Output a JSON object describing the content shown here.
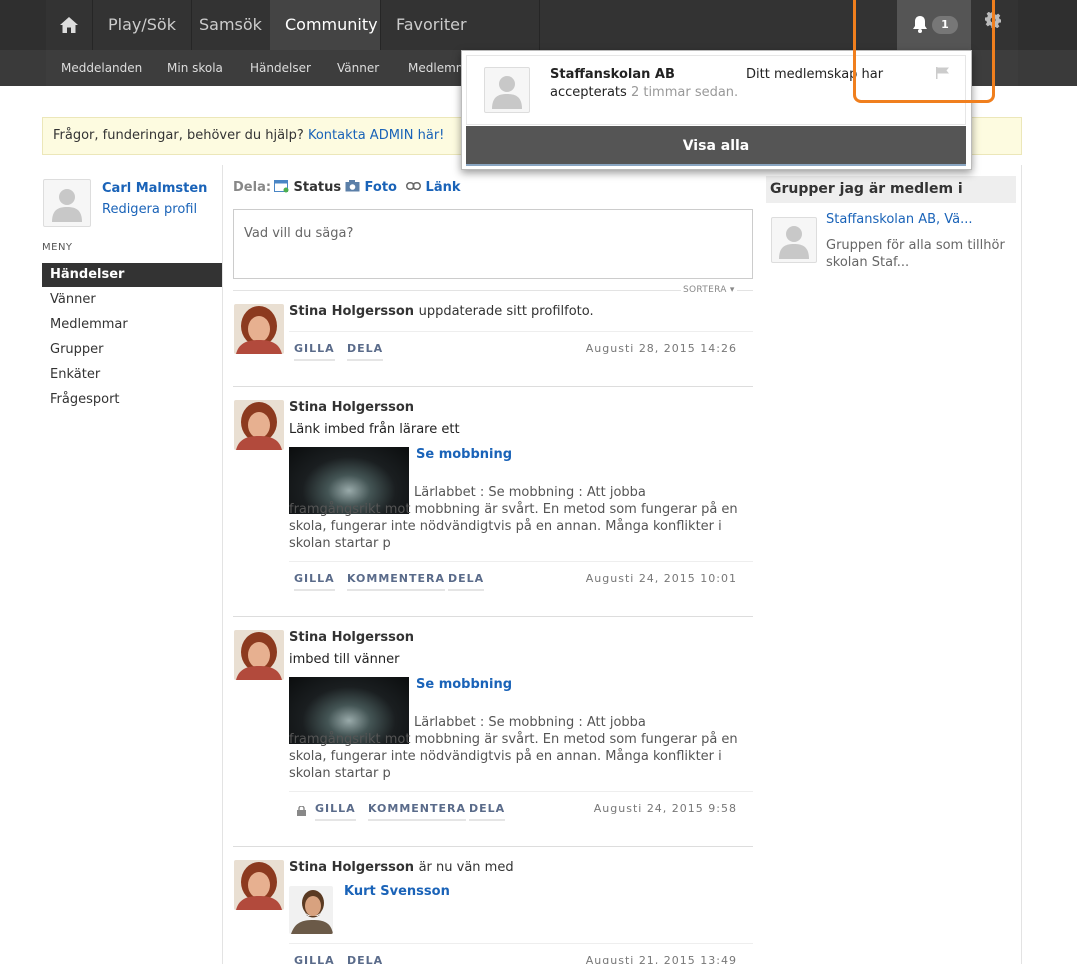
{
  "nav": {
    "items": [
      "Play/Sök",
      "Samsök",
      "Community",
      "Favoriter"
    ],
    "notification_count": "1"
  },
  "subnav": {
    "items": [
      "Meddelanden",
      "Min skola",
      "Händelser",
      "Vänner",
      "Medlemm"
    ]
  },
  "help": {
    "text": "Frågor, funderingar, behöver du hjälp?",
    "link": "Kontakta ADMIN här!"
  },
  "profile": {
    "name": "Carl Malmsten",
    "edit": "Redigera profil"
  },
  "menu": {
    "heading": "MENY",
    "items": [
      "Händelser",
      "Vänner",
      "Medlemmar",
      "Grupper",
      "Enkäter",
      "Frågesport"
    ]
  },
  "share": {
    "label": "Dela:",
    "tabs": [
      "Status",
      "Foto",
      "Länk"
    ],
    "placeholder": "Vad vill du säga?",
    "sort": "SORTERA"
  },
  "posts": [
    {
      "author": "Stina Holgersson",
      "action": "uppdaterade sitt profilfoto.",
      "actions": [
        "GILLA",
        "DELA"
      ],
      "time": "Augusti 28, 2015 14:26"
    },
    {
      "author": "Stina Holgersson",
      "text": "Länk imbed från lärare ett",
      "link_title": "Se mobbning",
      "link_desc": "Lärlabbet : Se mobbning : Att jobba framgångsrikt mot mobbning är svårt. En metod som fungerar på en skola, fungerar inte nödvändigtvis på en annan. Många konflikter i skolan startar p",
      "actions": [
        "GILLA",
        "KOMMENTERA",
        "DELA"
      ],
      "time": "Augusti 24, 2015 10:01"
    },
    {
      "author": "Stina Holgersson",
      "text": "imbed till vänner",
      "link_title": "Se mobbning",
      "link_desc": "Lärlabbet : Se mobbning : Att jobba framgångsrikt mot mobbning är svårt. En metod som fungerar på en skola, fungerar inte nödvändigtvis på en annan. Många konflikter i skolan startar p",
      "actions": [
        "GILLA",
        "KOMMENTERA",
        "DELA"
      ],
      "time": "Augusti 24, 2015 9:58"
    },
    {
      "author": "Stina Holgersson",
      "action": "är nu vän med",
      "friend": "Kurt Svensson",
      "actions": [
        "GILLA",
        "DELA"
      ],
      "time": "Augusti 21, 2015 13:49"
    }
  ],
  "groups": {
    "heading": "Grupper jag är medlem i",
    "items": [
      {
        "name": "Staffanskolan AB, Vä...",
        "desc": "Gruppen för alla som tillhör skolan Staf..."
      }
    ]
  },
  "notification": {
    "title": "Staffanskolan AB",
    "message_a": "Ditt medlemskap har",
    "message_b": "accepterats",
    "time": "2 timmar sedan.",
    "show_all": "Visa alla"
  },
  "colors": {
    "accent_orange": "#f07f1e",
    "link_blue": "#1a63b8"
  }
}
